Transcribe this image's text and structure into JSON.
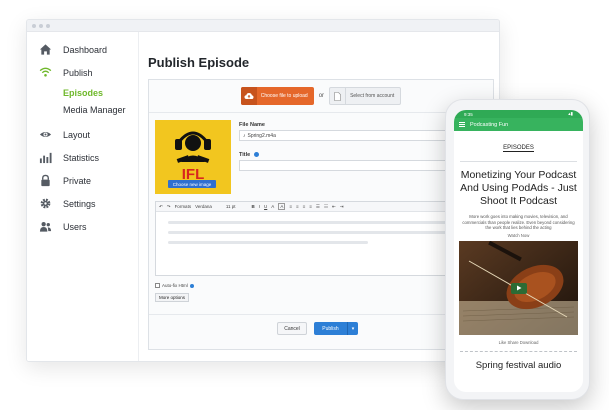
{
  "sidebar": {
    "items": [
      {
        "label": "Dashboard",
        "icon": "home-icon"
      },
      {
        "label": "Publish",
        "icon": "broadcast-icon"
      },
      {
        "label": "Layout",
        "icon": "eye-icon"
      },
      {
        "label": "Statistics",
        "icon": "bar-chart-icon"
      },
      {
        "label": "Private",
        "icon": "lock-icon"
      },
      {
        "label": "Settings",
        "icon": "gear-icon"
      },
      {
        "label": "Users",
        "icon": "users-icon"
      }
    ],
    "sub_items": [
      {
        "label": "Episodes",
        "active": true
      },
      {
        "label": "Media Manager",
        "active": false
      }
    ],
    "accent": "#6fb82b"
  },
  "main": {
    "title": "Publish Episode",
    "upload": {
      "choose_label": "Choose file to upload",
      "or_label": "or",
      "select_label": "Select from account"
    },
    "cover": {
      "art_text": "IFL",
      "change_label": "Choose new image"
    },
    "file_name": {
      "label": "File Name",
      "value": "Spring2.m4a"
    },
    "title_field": {
      "label": "Title",
      "value": ""
    },
    "editor": {
      "toolbar": [
        "Formats",
        "Verdana",
        "11 pt",
        "B",
        "I",
        "U",
        "A",
        "A"
      ]
    },
    "autofix_label": "Auto-fix Html",
    "more_options_label": "More options",
    "cancel_label": "Cancel",
    "publish_label": "Publish",
    "publish_color": "#2d7fd6"
  },
  "phone": {
    "status_time": "9:35",
    "app_title": "Podcasting Fun",
    "episodes_link": "EPISODES",
    "episode_title": "Monetizing Your Podcast And Using PodAds - Just Shoot It Podcast",
    "episode_desc": "More work goes into making movies, television, and commercials than people realize. Even beyond considering the work that lies behind the acting",
    "watch_label": "Watch Now",
    "share_row": "Like  Share  Download",
    "next_title": "Spring festival audio",
    "brand_color": "#37b35e"
  }
}
